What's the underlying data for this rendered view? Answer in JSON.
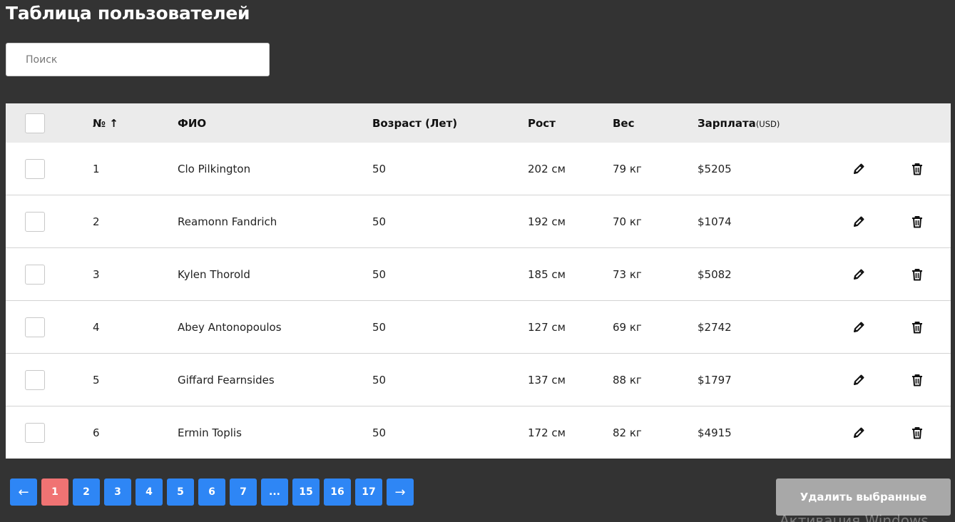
{
  "page": {
    "title": "Таблица пользователей"
  },
  "search": {
    "placeholder": "Поиск",
    "value": ""
  },
  "table": {
    "headers": {
      "num": "№ ↑",
      "fio": "ФИО",
      "age": "Возраст (Лет)",
      "height": "Рост",
      "weight": "Вес",
      "salary": "Зарплата",
      "salary_unit": "(USD)"
    },
    "rows": [
      {
        "num": "1",
        "fio": "Clo Pilkington",
        "age": "50",
        "height": "202 см",
        "weight": "79 кг",
        "salary": "$5205"
      },
      {
        "num": "2",
        "fio": "Reamonn Fandrich",
        "age": "50",
        "height": "192 см",
        "weight": "70 кг",
        "salary": "$1074"
      },
      {
        "num": "3",
        "fio": "Kylen Thorold",
        "age": "50",
        "height": "185 см",
        "weight": "73 кг",
        "salary": "$5082"
      },
      {
        "num": "4",
        "fio": "Abey Antonopoulos",
        "age": "50",
        "height": "127 см",
        "weight": "69 кг",
        "salary": "$2742"
      },
      {
        "num": "5",
        "fio": "Giffard Fearnsides",
        "age": "50",
        "height": "137 см",
        "weight": "88 кг",
        "salary": "$1797"
      },
      {
        "num": "6",
        "fio": "Ermin Toplis",
        "age": "50",
        "height": "172 см",
        "weight": "82 кг",
        "salary": "$4915"
      }
    ]
  },
  "pagination": {
    "prev": "←",
    "next": "→",
    "pages": [
      "1",
      "2",
      "3",
      "4",
      "5",
      "6",
      "7",
      "...",
      "15",
      "16",
      "17"
    ],
    "active_page": "1"
  },
  "actions": {
    "delete_selected": "Удалить выбранные"
  },
  "watermark": "Активация Windows",
  "colors": {
    "background": "#333333",
    "header_row": "#ebebeb",
    "page_button": "#2e86f5",
    "active_page": "#f07373",
    "disabled_button": "#a8a8a8"
  },
  "icons": {
    "edit": "pencil-icon",
    "delete": "trash-icon"
  }
}
